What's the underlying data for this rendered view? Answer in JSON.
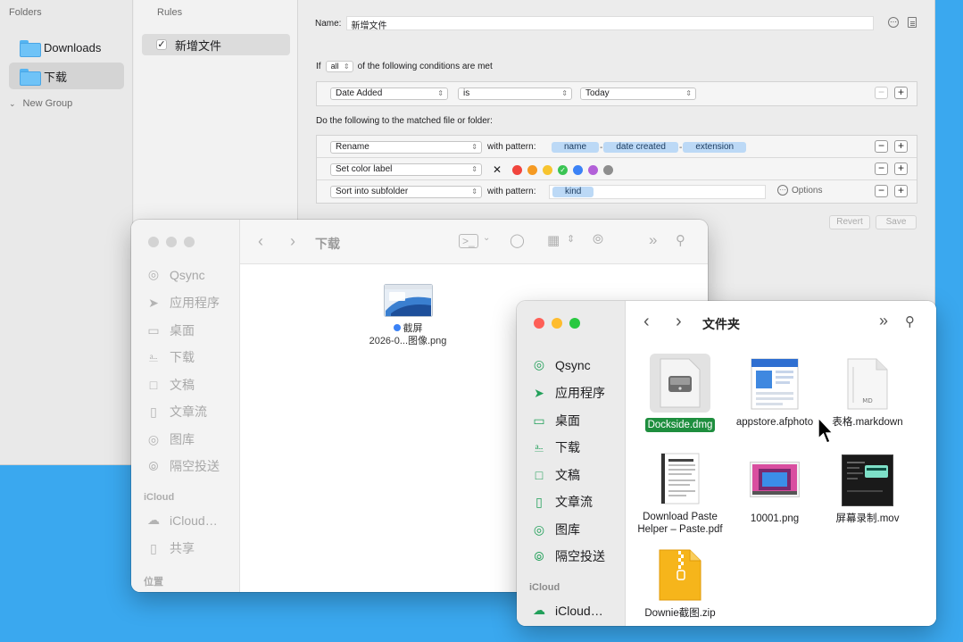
{
  "rules_app": {
    "folders_title": "Folders",
    "folders": [
      {
        "label": "Downloads",
        "selected": false
      },
      {
        "label": "下载",
        "selected": true
      }
    ],
    "new_group_label": "New Group",
    "rules_title": "Rules",
    "rules": [
      {
        "label": "新增文件",
        "checked": true
      }
    ],
    "name_label": "Name:",
    "name_value": "新增文件",
    "condition": {
      "prefix": "If",
      "quantifier": "all",
      "suffix": "of the following conditions are met",
      "rows": [
        {
          "attribute": "Date Added",
          "operator": "is",
          "value": "Today"
        }
      ]
    },
    "actions_title": "Do the following to the matched file or folder:",
    "actions": [
      {
        "action": "Rename",
        "with_label": "with pattern:",
        "tokens": [
          "name",
          "date created",
          "extension"
        ],
        "separator": "-"
      },
      {
        "action": "Set color label",
        "colors": [
          "#f1453d",
          "#f59a23",
          "#f7c42f",
          "#3ac453",
          "#3b82f6",
          "#b260d8",
          "#8e8e8e"
        ],
        "checked_index": 3
      },
      {
        "action": "Sort into subfolder",
        "with_label": "with pattern:",
        "tokens": [
          "kind"
        ],
        "options_label": "Options"
      }
    ],
    "revert_label": "Revert",
    "save_label": "Save",
    "minus": "−",
    "plus": "+"
  },
  "finder_back": {
    "title": "下载",
    "sidebar": {
      "favorites": [
        {
          "label": "Qsync",
          "icon": "sync-icon"
        },
        {
          "label": "应用程序",
          "icon": "applications-icon"
        },
        {
          "label": "桌面",
          "icon": "desktop-icon"
        },
        {
          "label": "下载",
          "icon": "downloads-icon"
        },
        {
          "label": "文稿",
          "icon": "document-icon"
        },
        {
          "label": "文章流",
          "icon": "folder-icon"
        },
        {
          "label": "图库",
          "icon": "photos-icon"
        },
        {
          "label": "隔空投送",
          "icon": "airdrop-icon"
        }
      ],
      "icloud_header": "iCloud",
      "icloud": [
        {
          "label": "iCloud…",
          "icon": "cloud-icon"
        },
        {
          "label": "共享",
          "icon": "shared-folder-icon"
        }
      ],
      "locations_header": "位置"
    },
    "files": [
      {
        "name_line1": "截屏",
        "name_line2": "2026-0...图像.png",
        "tag_color": "#3b82f6"
      }
    ]
  },
  "finder_front": {
    "title": "文件夹",
    "sidebar": {
      "favorites": [
        {
          "label": "Qsync",
          "icon": "sync-icon"
        },
        {
          "label": "应用程序",
          "icon": "applications-icon"
        },
        {
          "label": "桌面",
          "icon": "desktop-icon"
        },
        {
          "label": "下载",
          "icon": "downloads-icon"
        },
        {
          "label": "文稿",
          "icon": "document-icon"
        },
        {
          "label": "文章流",
          "icon": "folder-icon"
        },
        {
          "label": "图库",
          "icon": "photos-icon"
        },
        {
          "label": "隔空投送",
          "icon": "airdrop-icon"
        }
      ],
      "icloud_header": "iCloud",
      "icloud": [
        {
          "label": "iCloud…",
          "icon": "cloud-icon"
        }
      ]
    },
    "files": [
      {
        "name": "Dockside.dmg",
        "selected": true,
        "kind": "dmg"
      },
      {
        "name": "appstore.afphoto",
        "selected": false,
        "kind": "afphoto"
      },
      {
        "name": "表格.markdown",
        "selected": false,
        "kind": "markdown",
        "badge": "MD"
      },
      {
        "name": "Download Paste Helper – Paste.pdf",
        "selected": false,
        "kind": "pdf"
      },
      {
        "name": "10001.png",
        "selected": false,
        "kind": "png"
      },
      {
        "name": "屏幕录制.mov",
        "selected": false,
        "kind": "mov"
      },
      {
        "name": "Downie截图.zip",
        "selected": false,
        "kind": "zip"
      }
    ]
  }
}
